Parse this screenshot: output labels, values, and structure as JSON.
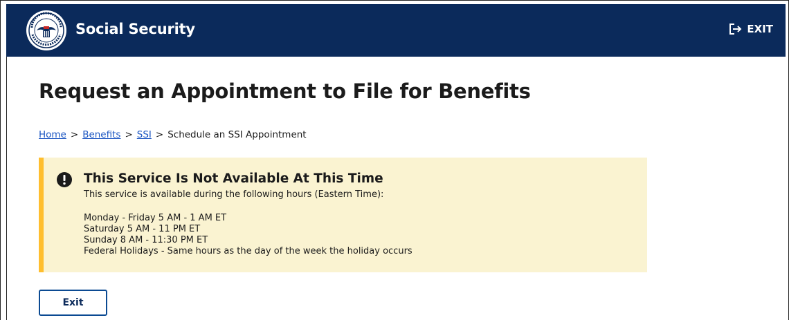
{
  "header": {
    "brand": "Social Security",
    "exit_label": "EXIT",
    "logo_icon": "ssa-seal-icon",
    "exit_icon": "sign-out-icon",
    "background": "#0b2a5b"
  },
  "page": {
    "title": "Request an Appointment to File for Benefits"
  },
  "breadcrumb": {
    "items": [
      {
        "label": "Home",
        "link": true
      },
      {
        "label": "Benefits",
        "link": true
      },
      {
        "label": "SSI",
        "link": true
      },
      {
        "label": "Schedule an SSI Appointment",
        "link": false
      }
    ],
    "separator": ">"
  },
  "alert": {
    "icon": "exclamation-circle-icon",
    "heading": "This Service Is Not Available At This Time",
    "lead": "This service is available during the following hours (Eastern Time):",
    "hours": [
      "Monday - Friday 5 AM - 1 AM ET",
      "Saturday 5 AM - 11 PM ET",
      "Sunday 8 AM - 11:30 PM ET",
      "Federal Holidays - Same hours as the day of the week the holiday occurs"
    ],
    "background": "#faf3d1",
    "accent": "#ffbe2e"
  },
  "actions": {
    "exit_label": "Exit"
  }
}
